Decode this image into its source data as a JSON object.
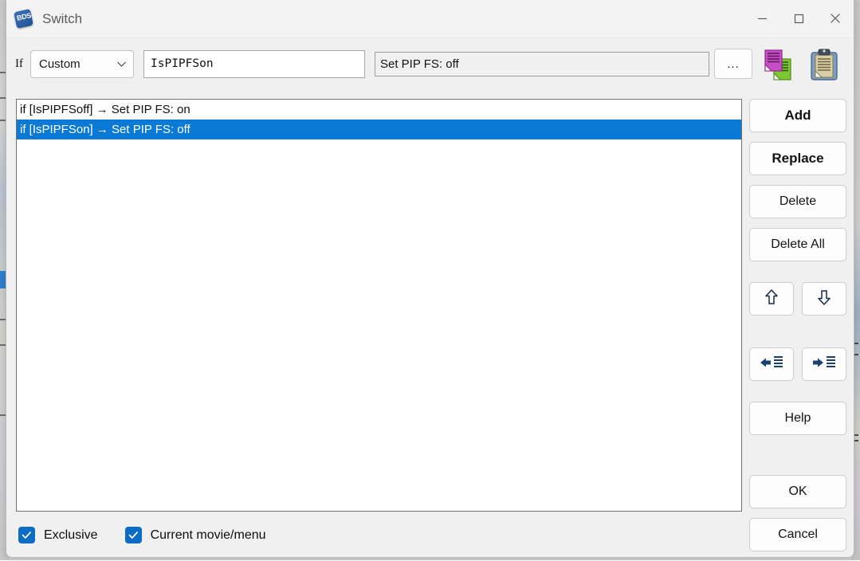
{
  "window": {
    "title": "Switch",
    "app_icon": "bds-app-icon",
    "icon_text": "BDS",
    "controls": {
      "minimize": "minimize-icon",
      "maximize": "maximize-icon",
      "close": "close-icon"
    }
  },
  "form": {
    "if_label": "If",
    "condition_type": {
      "value": "Custom",
      "options": [
        "Custom"
      ]
    },
    "condition_expression": {
      "value": "IsPIPFSon",
      "placeholder": ""
    },
    "action": {
      "value": "Set PIP FS: off",
      "placeholder": ""
    },
    "browse_button": "..."
  },
  "toolbar": {
    "copy_icon": "copy-icon",
    "paste_icon": "paste-clipboard-icon"
  },
  "list": {
    "items": [
      {
        "text": "if [IsPIPFSoff] → Set PIP FS: on",
        "selected": false
      },
      {
        "text": "if [IsPIPFSon] → Set PIP FS: off",
        "selected": true
      }
    ]
  },
  "options": {
    "exclusive": {
      "label": "Exclusive",
      "checked": true
    },
    "current_movie_menu": {
      "label": "Current movie/menu",
      "checked": true
    }
  },
  "buttons": {
    "add": "Add",
    "replace": "Replace",
    "delete": "Delete",
    "delete_all": "Delete All",
    "move_up": "move-up-icon",
    "move_down": "move-down-icon",
    "outdent": "outdent-icon",
    "indent": "indent-icon",
    "help": "Help",
    "ok": "OK",
    "cancel": "Cancel"
  },
  "colors": {
    "selection_blue": "#0a7ad6",
    "checkbox_blue": "#0a6cc4",
    "window_bg": "#f0f0f0",
    "titlebar_bg": "#f3f3f3",
    "icon_navy": "#1d4f91"
  }
}
